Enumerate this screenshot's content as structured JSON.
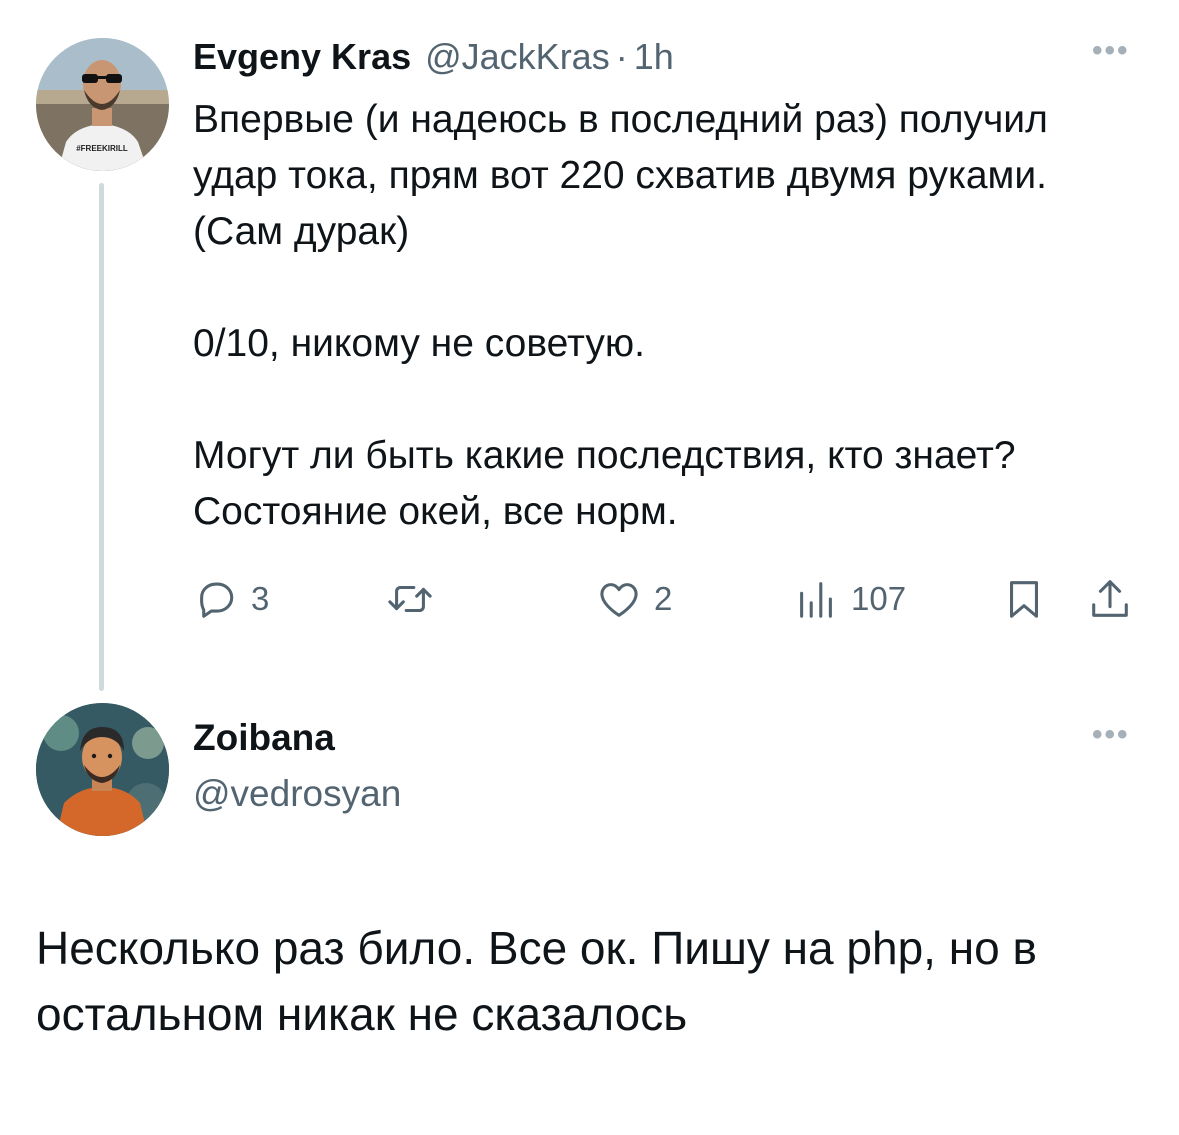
{
  "tweet1": {
    "author_name": "Evgeny Kras",
    "author_handle": "@JackKras",
    "separator": "·",
    "time": "1h",
    "more_label": "•••",
    "paragraphs": [
      "Впервые (и надеюсь в последний раз) получил удар тока, прям вот 220 схватив двумя руками. (Сам дурак)",
      "0/10, никому не советую.",
      "Могут ли быть какие последствия, кто знает? Состояние окей, все норм."
    ],
    "shirt_text": "#FREEKIRILL",
    "actions": {
      "reply_count": "3",
      "retweet_count": "",
      "like_count": "2",
      "views_count": "107"
    }
  },
  "tweet2": {
    "author_name": "Zoibana",
    "author_handle": "@vedrosyan",
    "more_label": "•••",
    "text": "Несколько раз било. Все ок. Пишу на php, но в остальном никак не сказалось"
  },
  "colors": {
    "text_primary": "#0f1419",
    "text_secondary": "#536471",
    "thread_line": "#cfd9de",
    "background": "#ffffff"
  },
  "icons": {
    "reply": "reply-icon",
    "retweet": "retweet-icon",
    "like": "heart-icon",
    "views": "views-icon",
    "bookmark": "bookmark-icon",
    "share": "share-icon",
    "more": "more-icon"
  }
}
